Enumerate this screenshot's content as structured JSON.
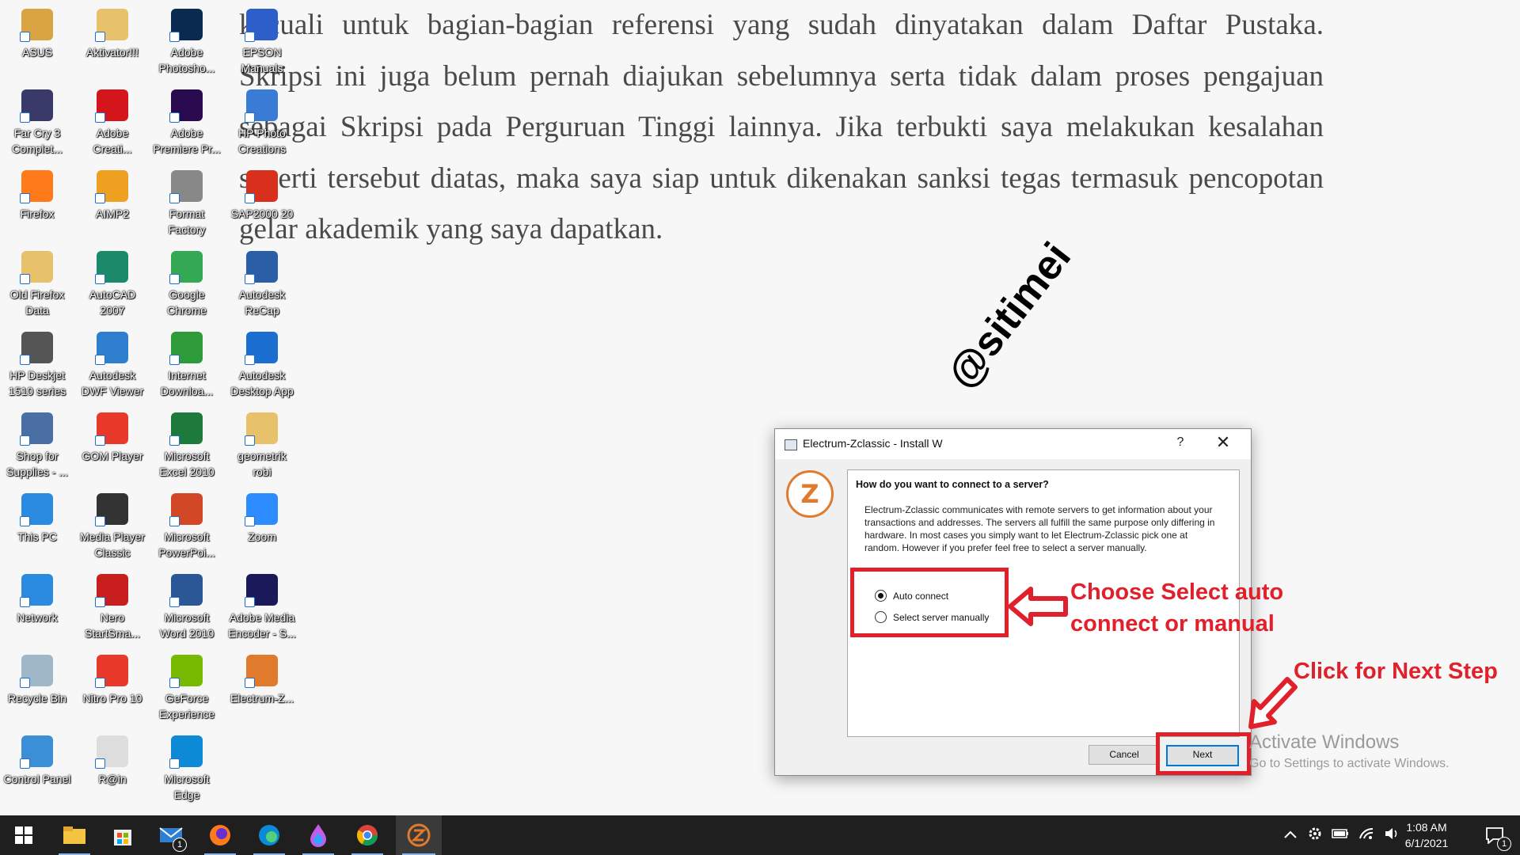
{
  "wallpaper": {
    "lines": [
      "kecuali untuk bagian-bagian referensi yang sudah dinyatakan dalam Daftar Pustaka.",
      "Skripsi ini juga belum pernah diajukan sebelumnya serta tidak dalam proses pengajuan",
      "sebagai Skripsi pada Perguruan Tinggi lainnya. Jika terbukti saya melakukan kesalahan",
      "seperti tersebut diatas, maka saya siap untuk dikenakan sanksi tegas termasuk pencopotan",
      "gelar akademik yang saya dapatkan."
    ]
  },
  "desktop_icons": [
    {
      "label": "ASUS",
      "color": "#d9a441"
    },
    {
      "label": "Aktivator!!!",
      "color": "#e8c26a"
    },
    {
      "label": "Adobe Photosho...",
      "color": "#0a2a4f"
    },
    {
      "label": "EPSON Manuals",
      "color": "#2d5ec9"
    },
    {
      "label": "Far Cry 3 Complet...",
      "color": "#3a3a6a"
    },
    {
      "label": "Adobe Creati...",
      "color": "#d4151c"
    },
    {
      "label": "Adobe Premiere Pr...",
      "color": "#2a0a4f"
    },
    {
      "label": "HP Photo Creations",
      "color": "#3a7bd5"
    },
    {
      "label": "Firefox",
      "color": "#ff7a1a"
    },
    {
      "label": "AIMP2",
      "color": "#f0a020"
    },
    {
      "label": "Format Factory",
      "color": "#888888"
    },
    {
      "label": "SAP2000 20",
      "color": "#d9301e"
    },
    {
      "label": "Old Firefox Data",
      "color": "#e8c26a"
    },
    {
      "label": "AutoCAD 2007",
      "color": "#1b8a6b"
    },
    {
      "label": "Google Chrome",
      "color": "#34a853"
    },
    {
      "label": "Autodesk ReCap",
      "color": "#2a5fa8"
    },
    {
      "label": "HP Deskjet 1510 series",
      "color": "#555555"
    },
    {
      "label": "Autodesk DWF Viewer",
      "color": "#2f7fd1"
    },
    {
      "label": "Internet Downloa...",
      "color": "#2d9b3a"
    },
    {
      "label": "Autodesk Desktop App",
      "color": "#1b6fd1"
    },
    {
      "label": "Shop for Supplies - ...",
      "color": "#4a6fa5"
    },
    {
      "label": "GOM Player",
      "color": "#e8392b"
    },
    {
      "label": "Microsoft Excel 2010",
      "color": "#1d7a3c"
    },
    {
      "label": "geometrik robi",
      "color": "#e8c26a"
    },
    {
      "label": "This PC",
      "color": "#2a8be0"
    },
    {
      "label": "Media Player Classic",
      "color": "#333333"
    },
    {
      "label": "Microsoft PowerPoi...",
      "color": "#d24726"
    },
    {
      "label": "Zoom",
      "color": "#2d8cff"
    },
    {
      "label": "Network",
      "color": "#2a8be0"
    },
    {
      "label": "Nero StartSma...",
      "color": "#c81e1e"
    },
    {
      "label": "Microsoft Word 2010",
      "color": "#2b5797"
    },
    {
      "label": "Adobe Media Encoder - S...",
      "color": "#1a1a5a"
    },
    {
      "label": "Recycle Bin",
      "color": "#9fb8c8"
    },
    {
      "label": "Nitro Pro 10",
      "color": "#e8392b"
    },
    {
      "label": "GeForce Experience",
      "color": "#76b900"
    },
    {
      "label": "Electrum-Z...",
      "color": "#e07a2c"
    },
    {
      "label": "Control Panel",
      "color": "#3b8fd6"
    },
    {
      "label": "R@in",
      "color": "#dddddd"
    },
    {
      "label": "Microsoft Edge",
      "color": "#0c8ad6"
    }
  ],
  "dialog": {
    "title": "Electrum-Zclassic  -  Install W",
    "help_icon": "?",
    "close_icon": "✕",
    "logo_glyph": "Z",
    "question": "How do you want to connect to a server?",
    "description": "Electrum-Zclassic communicates with remote servers to get information about your transactions and addresses. The servers all fulfill the same purpose only differing in hardware. In most cases you simply want to let Electrum-Zclassic pick one at random.  However if you prefer feel free to select a server manually.",
    "options": [
      {
        "label": "Auto connect",
        "selected": true
      },
      {
        "label": "Select server manually",
        "selected": false
      }
    ],
    "cancel_label": "Cancel",
    "next_label": "Next"
  },
  "annotations": {
    "choose_line1": "Choose Select auto",
    "choose_line2": "connect or manual",
    "next_step": "Click for Next Step",
    "accent_color": "#e0202a"
  },
  "watermark": "@sitimei",
  "activate": {
    "line1": "Activate Windows",
    "line2": "Go to Settings to activate Windows."
  },
  "taskbar": {
    "mail_badge": "1",
    "time": "1:08 AM",
    "date": "6/1/2021",
    "notification_badge": "1"
  }
}
